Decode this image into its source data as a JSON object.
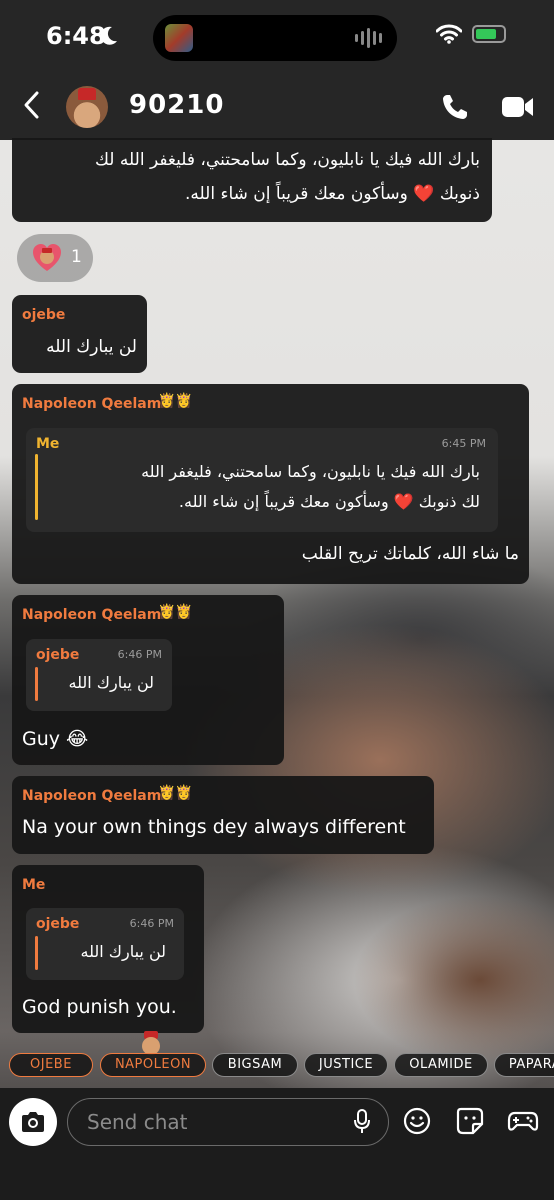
{
  "status_bar": {
    "time": "6:48"
  },
  "header": {
    "contact_name": "90210",
    "back_icon": "chevron-left-icon"
  },
  "reaction": {
    "count": "1"
  },
  "messages": {
    "m1": {
      "text_line1": "بارك الله فيك يا نابليون، وكما سامحتني، فليغفر الله لك",
      "text_line2": "ذنوبك ❤️ وسأكون معك قريباً إن شاء الله."
    },
    "m2": {
      "sender": "ojebe",
      "text": "لن يبارك الله"
    },
    "m3": {
      "sender": "Napoleon Qeelam",
      "crowns": "👸👸",
      "quote_sender": "Me",
      "quote_time": "6:45 PM",
      "quote_line1": "بارك الله فيك يا نابليون، وكما سامحتني، فليغفر الله",
      "quote_line2": "لك ذنوبك ❤️ وسأكون معك قريباً إن شاء الله.",
      "text": "ما شاء الله، كلماتك تريح القلب"
    },
    "m4": {
      "sender": "Napoleon Qeelam",
      "crowns": "👸👸",
      "quote_sender": "ojebe",
      "quote_time": "6:46 PM",
      "quote_text": "لن يبارك الله",
      "text": "Guy 😂"
    },
    "m5": {
      "sender": "Napoleon Qeelam",
      "crowns": "👸👸",
      "text": "Na your own things dey always different"
    },
    "m6": {
      "sender": "Me",
      "quote_sender": "ojebe",
      "quote_time": "6:46 PM",
      "quote_text": "لن يبارك الله",
      "text": "God punish you."
    }
  },
  "pills": [
    "OJEBE",
    "NAPOLEON",
    "BIGSAM",
    "JUSTICE",
    "OLAMIDE",
    "PAPARA"
  ],
  "composer": {
    "placeholder": "Send chat"
  },
  "colors": {
    "orange": "#f07b3f",
    "gold": "#f0b430",
    "bubble": "#161616"
  }
}
